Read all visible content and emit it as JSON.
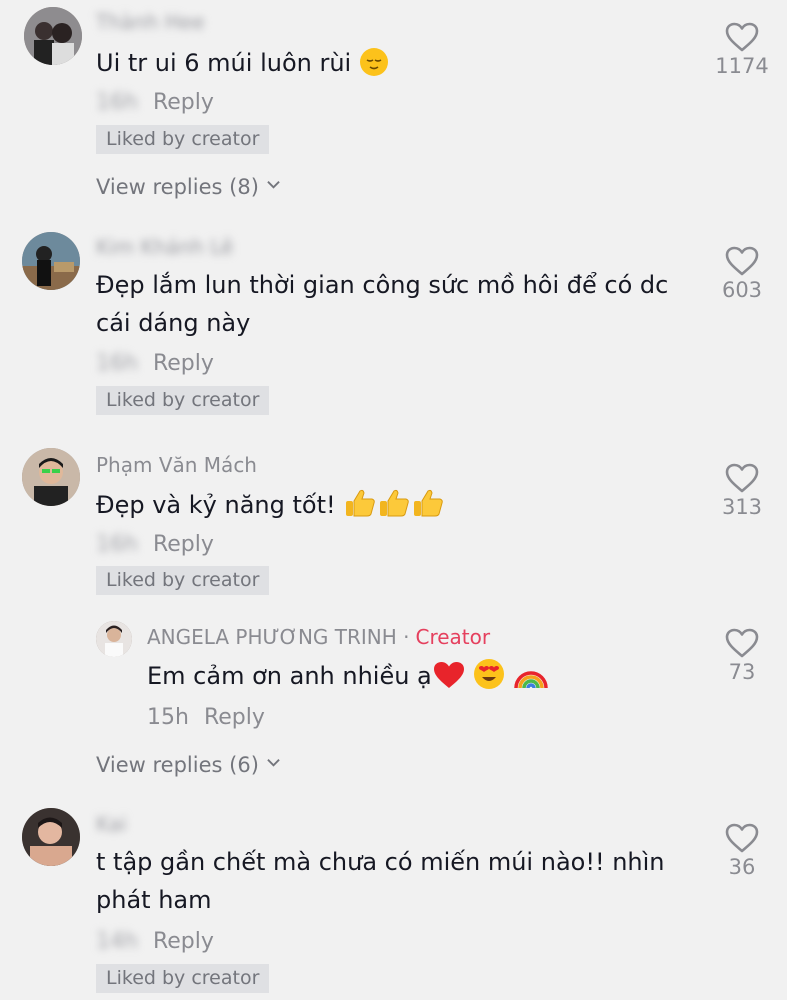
{
  "comments": [
    {
      "username": "Thành Hee",
      "text": "Ui tr ui 6 múi luôn rùi",
      "time": "16h",
      "reply_label": "Reply",
      "liked_label": "Liked by creator",
      "likes": "1174",
      "view_replies": "View replies (8)",
      "emoji": [
        "relieved-face-icon"
      ]
    },
    {
      "username": "Kim Khánh Lê",
      "text_line1": "Đẹp lắm lun thời gian công sức mồ hôi để có dc",
      "text_line2": "cái dáng này",
      "time": "16h",
      "reply_label": "Reply",
      "liked_label": "Liked by creator",
      "likes": "603"
    },
    {
      "username": "Phạm Văn Mách",
      "text": "Đẹp và kỷ năng tốt!",
      "time": "16h",
      "reply_label": "Reply",
      "liked_label": "Liked by creator",
      "likes": "313",
      "emoji": [
        "thumbs-up-icon",
        "thumbs-up-icon",
        "thumbs-up-icon"
      ],
      "view_replies": "View replies (6)",
      "reply": {
        "username": "ANGELA PHƯƠNG TRINH",
        "separator": "·",
        "creator_label": "Creator",
        "text": "Em cảm ơn anh nhiều ạ",
        "time": "15h",
        "reply_label": "Reply",
        "likes": "73",
        "emoji": [
          "red-heart-icon",
          "heart-eyes-face-icon",
          "rainbow-icon"
        ]
      }
    },
    {
      "username": "Kai",
      "text_line1": "t tập gần chết mà chưa có miến múi nào!! nhìn",
      "text_line2": "phát ham",
      "time": "14h",
      "reply_label": "Reply",
      "liked_label": "Liked by creator",
      "likes": "36"
    }
  ],
  "colors": {
    "background": "#f1f1f1",
    "primary_text": "#161823",
    "secondary_text": "#8a8b91",
    "creator_accent": "#e5405e",
    "liked_badge_bg": "#dfe0e3"
  }
}
